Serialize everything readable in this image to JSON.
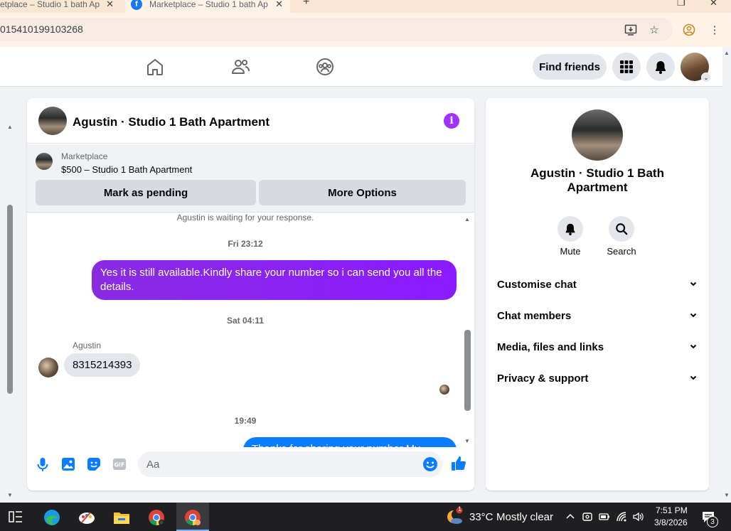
{
  "browser": {
    "tabs": [
      {
        "title": "etplace – Studio 1 bath Ap"
      },
      {
        "title": "Marketplace – Studio 1 bath Ap"
      }
    ],
    "url": "015410199103268"
  },
  "fb_nav": {
    "find_friends": "Find friends"
  },
  "chat": {
    "title": "Agustin · Studio 1 Bath Apartment",
    "listing": {
      "kicker": "Marketplace",
      "title": "$500 – Studio 1 Bath Apartment",
      "mark_pending": "Mark as pending",
      "more_options": "More Options"
    },
    "system_note": "Agustin is waiting for your response.",
    "messages": [
      {
        "time": "Fri 23:12",
        "text": "Yes it is still available.Kindly share your number so i can send you all the details."
      },
      {
        "time": "Sat 04:11",
        "sender": "Agustin",
        "text": "8315214393"
      },
      {
        "time": "19:49",
        "text": "Thanks for sharing your number My"
      }
    ],
    "composer_placeholder": "Aa"
  },
  "details": {
    "name": "Agustin · Studio 1 Bath Apartment",
    "actions": {
      "mute": "Mute",
      "search": "Search"
    },
    "sections": [
      "Customise chat",
      "Chat members",
      "Media, files and links",
      "Privacy & support"
    ]
  },
  "taskbar": {
    "weather_temp": "33°C",
    "weather_text": "Mostly clear",
    "weather_badge": "1",
    "time": "7:51 PM",
    "date": "3/8/2026",
    "notif_count": "3"
  },
  "colors": {
    "messenger_purple": "#8a1bff",
    "fb_blue": "#0a7cff",
    "info_purple": "#a033ff"
  }
}
